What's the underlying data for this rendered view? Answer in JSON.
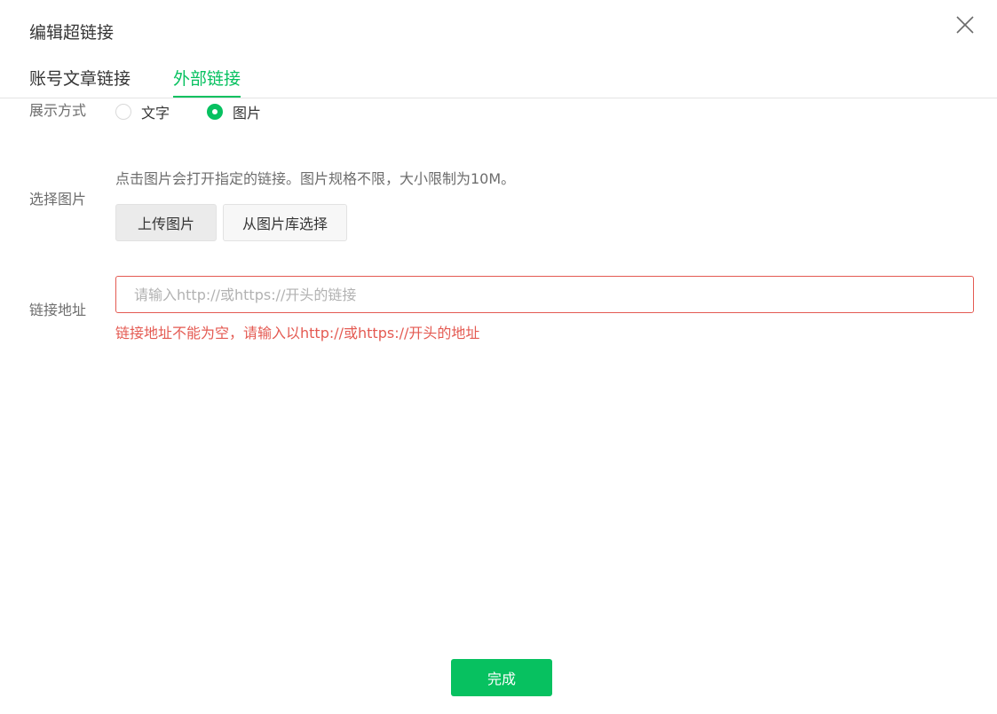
{
  "dialog": {
    "title": "编辑超链接"
  },
  "tabs": [
    {
      "label": "账号文章链接",
      "active": false
    },
    {
      "label": "外部链接",
      "active": true
    }
  ],
  "display_mode": {
    "label": "展示方式",
    "options": [
      {
        "label": "文字",
        "selected": false
      },
      {
        "label": "图片",
        "selected": true
      }
    ]
  },
  "select_image": {
    "label": "选择图片",
    "hint": "点击图片会打开指定的链接。图片规格不限，大小限制为10M。",
    "upload_label": "上传图片",
    "library_label": "从图片库选择"
  },
  "link_address": {
    "label": "链接地址",
    "value": "",
    "placeholder": "请输入http://或https://开头的链接",
    "error": "链接地址不能为空，请输入以http://或https://开头的地址"
  },
  "footer": {
    "done_label": "完成"
  },
  "icons": {
    "close": "close-icon"
  },
  "colors": {
    "accent": "#07c160",
    "error": "#e45a52",
    "text": "#353535",
    "muted": "#6d6d6d"
  }
}
